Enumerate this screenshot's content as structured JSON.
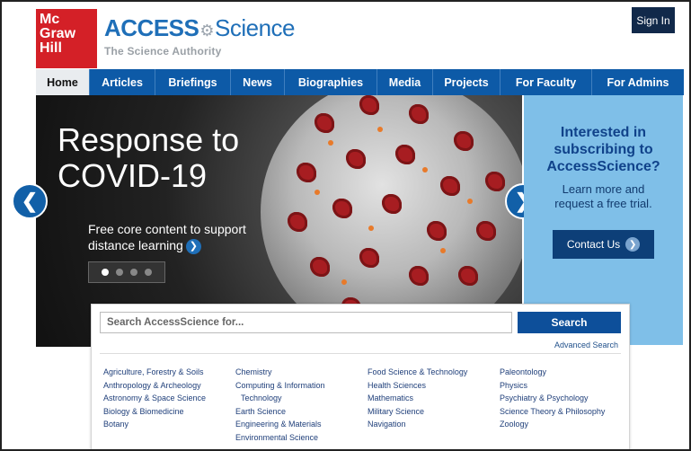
{
  "header": {
    "logo_lines": [
      "Mc",
      "Graw",
      "Hill"
    ],
    "brand_access": "ACCESS",
    "brand_science": "Science",
    "brand_tagline": "The Science Authority",
    "signin_label": "Sign In"
  },
  "nav": {
    "items": [
      "Home",
      "Articles",
      "Briefings",
      "News",
      "Biographies",
      "Media",
      "Projects",
      "For Faculty",
      "For Admins"
    ]
  },
  "hero": {
    "title_line1": "Response to",
    "title_line2": "COVID-19",
    "subtitle": "Free core content to support distance learning",
    "slide_count": 4,
    "active_slide": 1
  },
  "promo": {
    "title": "Interested in subscribing to AccessScience?",
    "text": "Learn more and request a free trial.",
    "button_label": "Contact Us"
  },
  "search": {
    "placeholder": "Search AccessScience for...",
    "button_label": "Search",
    "advanced_label": "Advanced Search"
  },
  "subjects": {
    "col1": [
      "Agriculture, Forestry & Soils",
      "Anthropology & Archeology",
      "Astronomy & Space Science",
      "Biology & Biomedicine",
      "Botany"
    ],
    "col2": [
      "Chemistry",
      "Computing & Information",
      "Technology",
      "Earth Science",
      "Engineering & Materials",
      "Environmental Science"
    ],
    "col3": [
      "Food Science & Technology",
      "Health Sciences",
      "Mathematics",
      "Military Science",
      "Navigation"
    ],
    "col4": [
      "Paleontology",
      "Physics",
      "Psychiatry & Psychology",
      "Science Theory & Philosophy",
      "Zoology"
    ]
  },
  "colors": {
    "brand_red": "#d42027",
    "nav_blue": "#0d5aa7",
    "promo_bg": "#7fbfe8",
    "dark_navy": "#11294a"
  }
}
